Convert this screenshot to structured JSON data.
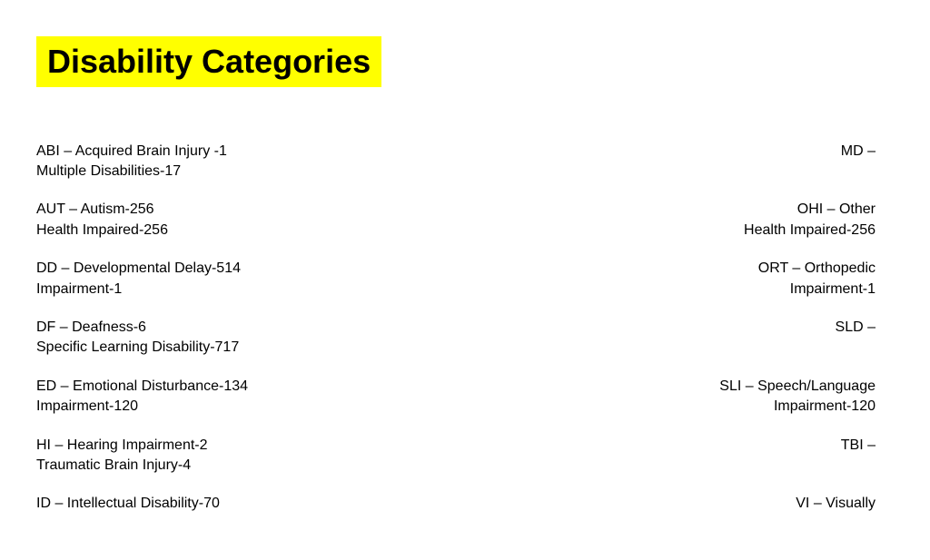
{
  "page": {
    "title": "Disability Categories",
    "title_bg_color": "#FFFF00"
  },
  "categories": {
    "left": [
      {
        "id": "abi",
        "line1": "ABI – Acquired Brain Injury -1",
        "line2": "Multiple Disabilities-17"
      },
      {
        "id": "aut",
        "line1": "AUT – Autism-256",
        "line2": "Health Impaired-256"
      },
      {
        "id": "dd",
        "line1": "DD – Developmental Delay-514",
        "line2": "Impairment-1"
      },
      {
        "id": "df",
        "line1": "DF – Deafness-6",
        "line2": "Specific Learning Disability-717"
      },
      {
        "id": "ed",
        "line1": "ED – Emotional Disturbance-134",
        "line2": "Impairment-120"
      },
      {
        "id": "hi",
        "line1": "HI – Hearing Impairment-2",
        "line2": "Traumatic Brain Injury-4"
      },
      {
        "id": "id",
        "line1": "ID – Intellectual Disability-70",
        "line2": ""
      }
    ],
    "right": [
      {
        "id": "md",
        "line1": "MD –",
        "line2": ""
      },
      {
        "id": "ohi",
        "line1": "OHI – Other",
        "line2": "Health Impaired-256"
      },
      {
        "id": "ort",
        "line1": "ORT – Orthopedic",
        "line2": "Impairment-1"
      },
      {
        "id": "sld",
        "line1": "SLD –",
        "line2": ""
      },
      {
        "id": "sli",
        "line1": "SLI – Speech/Language",
        "line2": "Impairment-120"
      },
      {
        "id": "tbi",
        "line1": "TBI –",
        "line2": ""
      },
      {
        "id": "vi",
        "line1": "VI – Visually",
        "line2": ""
      }
    ]
  }
}
